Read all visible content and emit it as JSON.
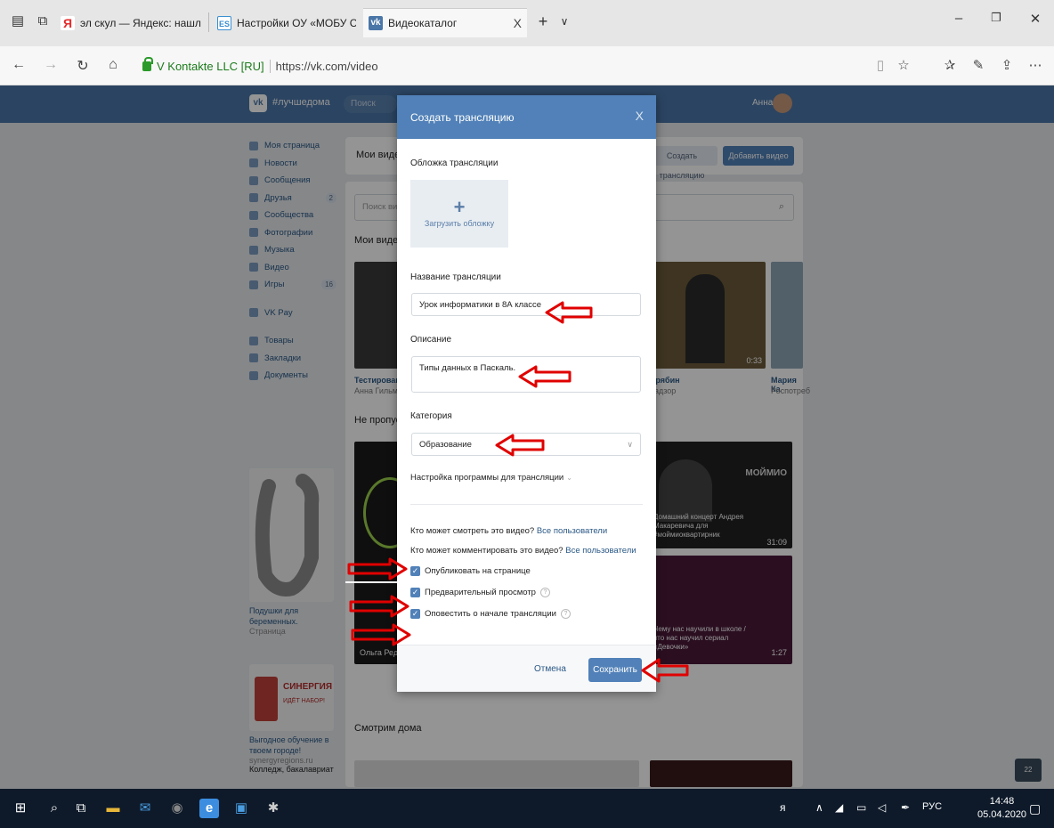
{
  "browser": {
    "tabs": [
      {
        "label": "эл скул — Яндекс: нашлось",
        "favicon": "Я",
        "favicon_color": "#e52b2b"
      },
      {
        "label": "Настройки ОУ «МОБУ СОШ",
        "favicon": "ES",
        "favicon_color": "#3a8fd1"
      },
      {
        "label": "Видеокаталог",
        "favicon": "vk",
        "favicon_color": "#4a76a8"
      }
    ],
    "new_tab": "+",
    "tab_close": "X",
    "ev_name": "V Kontakte LLC [RU]",
    "url": "https://vk.com/video"
  },
  "vk": {
    "logo": "vk",
    "header_tag": "#лучшедома",
    "search_placeholder": "Поиск",
    "user_name": "Анна",
    "menu": [
      {
        "label": "Моя страница"
      },
      {
        "label": "Новости"
      },
      {
        "label": "Сообщения"
      },
      {
        "label": "Друзья",
        "badge": "2"
      },
      {
        "label": "Сообщества"
      },
      {
        "label": "Фотографии"
      },
      {
        "label": "Музыка"
      },
      {
        "label": "Видео"
      },
      {
        "label": "Игры",
        "badge": "16"
      },
      {
        "label": "VK Pay"
      },
      {
        "label": "Товары"
      },
      {
        "label": "Закладки"
      },
      {
        "label": "Документы"
      }
    ],
    "ad1": {
      "title": "Подушки для беременных.",
      "sub": "Страница"
    },
    "ad2": {
      "banner": "СИНЕРГИЯ",
      "banner_sub": "ИДЁТ НАБОР!",
      "title": "Выгодное обучение в твоем городе!",
      "sub": "synergyregions.ru",
      "extra": "Колледж, бакалавриат"
    },
    "my_videos_tab": "Мои видео",
    "create_stream_btn": "Создать трансляцию",
    "add_video_btn": "Добавить видео",
    "search_videos": "Поиск видео",
    "my_videos_heading": "Мои видео",
    "missed_heading": "Не пропустите",
    "watch_home_heading": "Смотрим дома",
    "video1_title": "Тестирование",
    "video1_author": "Анна Гильман",
    "video2_title": "Дрябин",
    "video2_author": "надзор",
    "video3_title": "Мария Ка",
    "video3_author": "Роспотреб",
    "video_duration": "0:33",
    "promo1": "Домашний концерт Андрея Макаревича для #моймиоквартирник",
    "promo1_badge": "МОЙМИО",
    "promo1_time": "31:09",
    "promo2": "Чему нас научили в школе / что нас научил сериал «Девочки»",
    "promo2_time": "1:27",
    "promo3_author": "Ольга Редько",
    "online_count": "22"
  },
  "modal": {
    "title": "Создать трансляцию",
    "close": "X",
    "cover_label": "Обложка трансляции",
    "cover_plus": "+",
    "cover_upload": "Загрузить обложку",
    "name_label": "Название трансляции",
    "name_value": "Урок информатики в 8А классе",
    "desc_label": "Описание",
    "desc_value": "Типы данных в Паскаль.",
    "category_label": "Категория",
    "category_value": "Образование",
    "program_settings": "Настройка программы для трансляции",
    "who_watch": "Кто может смотреть это видео?",
    "who_watch_value": "Все пользователи",
    "who_comment": "Кто может комментировать это видео?",
    "who_comment_value": "Все пользователи",
    "chk_publish": "Опубликовать на странице",
    "chk_preview": "Предварительный просмотр",
    "chk_notify": "Оповестить о начале трансляции",
    "cancel": "Отмена",
    "save": "Сохранить"
  },
  "taskbar": {
    "lang": "РУС",
    "time": "14:48",
    "date": "05.04.2020"
  },
  "colors": {
    "vk_blue": "#4a76a8",
    "modal_header": "#5181b8",
    "annotation_red": "#e00000"
  }
}
